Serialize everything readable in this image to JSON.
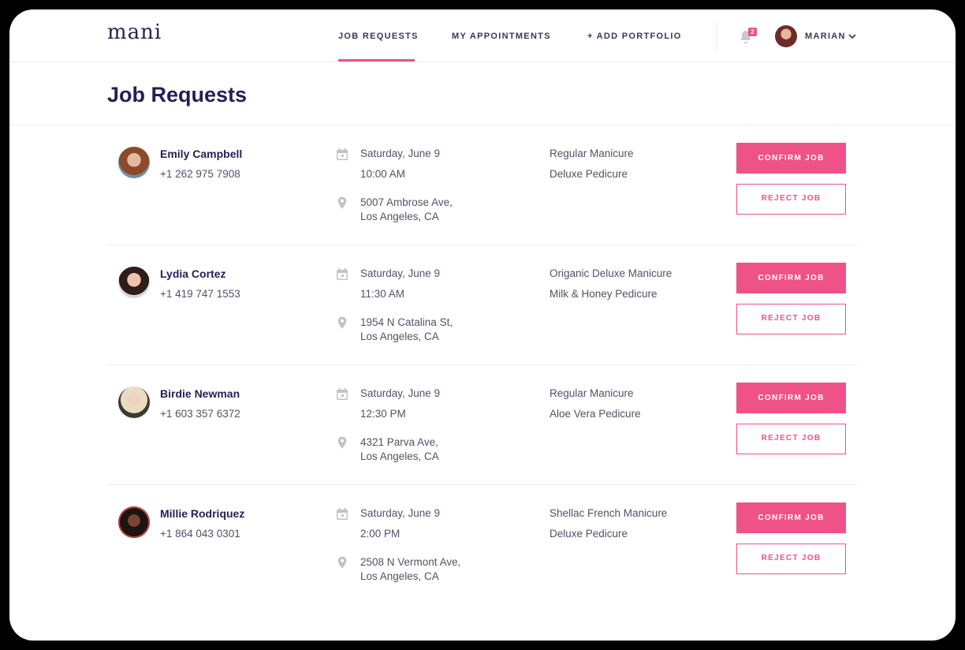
{
  "app": {
    "logo": "mani",
    "accent": "#ef5286"
  },
  "nav": {
    "items": [
      {
        "label": "JOB REQUESTS",
        "active": true
      },
      {
        "label": "MY APPOINTMENTS",
        "active": false
      },
      {
        "label": "+ ADD PORTFOLIO",
        "active": false
      }
    ],
    "notifications": {
      "icon": "bell-icon",
      "count": "2"
    },
    "user": {
      "name": "MARIAN"
    }
  },
  "page": {
    "title": "Job Requests"
  },
  "jobs": [
    {
      "name": "Emily Campbell",
      "phone": "+1 262 975 7908",
      "date": "Saturday, June 9",
      "time": "10:00 AM",
      "address_line1": "5007 Ambrose Ave,",
      "address_line2": "Los Angeles, CA",
      "services": [
        "Regular Manicure",
        "Deluxe Pedicure"
      ],
      "confirm_label": "CONFIRM JOB",
      "reject_label": "REJECT JOB"
    },
    {
      "name": "Lydia Cortez",
      "phone": "+1 419 747 1553",
      "date": "Saturday, June 9",
      "time": "11:30 AM",
      "address_line1": "1954 N Catalina St,",
      "address_line2": "Los Angeles, CA",
      "services": [
        "Origanic Deluxe Manicure",
        "Milk & Honey Pedicure"
      ],
      "confirm_label": "CONFIRM JOB",
      "reject_label": "REJECT JOB"
    },
    {
      "name": "Birdie Newman",
      "phone": "+1 603 357 6372",
      "date": "Saturday, June 9",
      "time": "12:30 PM",
      "address_line1": "4321 Parva Ave,",
      "address_line2": "Los Angeles, CA",
      "services": [
        "Regular Manicure",
        "Aloe Vera Pedicure"
      ],
      "confirm_label": "CONFIRM JOB",
      "reject_label": "REJECT JOB"
    },
    {
      "name": "Millie Rodriquez",
      "phone": "+1 864 043 0301",
      "date": "Saturday, June 9",
      "time": "2:00 PM",
      "address_line1": "2508 N Vermont Ave,",
      "address_line2": "Los Angeles, CA",
      "services": [
        "Shellac French Manicure",
        "Deluxe Pedicure"
      ],
      "confirm_label": "CONFIRM JOB",
      "reject_label": "REJECT JOB"
    }
  ]
}
